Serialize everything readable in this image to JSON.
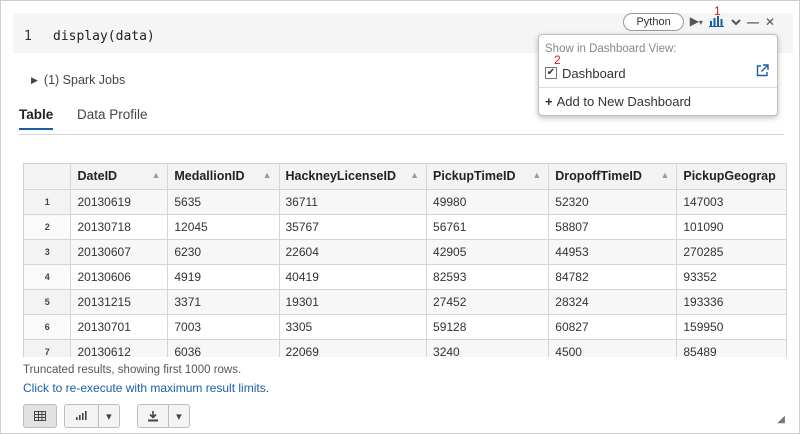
{
  "cell": {
    "line_number": "1",
    "code": "display(data)",
    "language_label": "Python",
    "marker_1": "1",
    "marker_2": "2"
  },
  "toolbar_icons": [
    "run-icon",
    "bar-chart-icon",
    "chevron-down-icon",
    "minimize-icon",
    "close-icon"
  ],
  "spark_jobs": {
    "label": "(1) Spark Jobs"
  },
  "tabs": [
    {
      "label": "Table",
      "active": true
    },
    {
      "label": "Data Profile",
      "active": false
    }
  ],
  "table": {
    "columns": [
      "DateID",
      "MedallionID",
      "HackneyLicenseID",
      "PickupTimeID",
      "DropoffTimeID",
      "PickupGeograp"
    ],
    "rows": [
      {
        "index": "1",
        "cells": [
          "20130619",
          "5635",
          "36711",
          "49980",
          "52320",
          "147003"
        ]
      },
      {
        "index": "2",
        "cells": [
          "20130718",
          "12045",
          "35767",
          "56761",
          "58807",
          "101090"
        ]
      },
      {
        "index": "3",
        "cells": [
          "20130607",
          "6230",
          "22604",
          "42905",
          "44953",
          "270285"
        ]
      },
      {
        "index": "4",
        "cells": [
          "20130606",
          "4919",
          "40419",
          "82593",
          "84782",
          "93352"
        ]
      },
      {
        "index": "5",
        "cells": [
          "20131215",
          "3371",
          "19301",
          "27452",
          "28324",
          "193336"
        ]
      },
      {
        "index": "6",
        "cells": [
          "20130701",
          "7003",
          "3305",
          "59128",
          "60827",
          "159950"
        ]
      },
      {
        "index": "7",
        "cells": [
          "20130612",
          "6036",
          "22069",
          "3240",
          "4500",
          "85489"
        ]
      }
    ]
  },
  "footer": {
    "truncated_text": "Truncated results, showing first 1000 rows.",
    "rerun_link": "Click to re-execute with maximum result limits."
  },
  "popup": {
    "heading": "Show in Dashboard View:",
    "dashboard_label": "Dashboard",
    "dashboard_checked": true,
    "add_label": "Add to New Dashboard"
  },
  "colors": {
    "accent": "#1a5fa6",
    "marker": "#d21f1f",
    "code_background": "#f5f5f5"
  }
}
